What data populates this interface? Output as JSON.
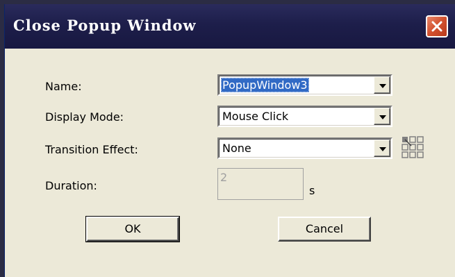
{
  "window": {
    "title": "Close Popup Window"
  },
  "form": {
    "name": {
      "label": "Name:",
      "value": "PopupWindow3"
    },
    "display_mode": {
      "label": "Display Mode:",
      "value": "Mouse Click"
    },
    "transition_effect": {
      "label": "Transition Effect:",
      "value": "None"
    },
    "duration": {
      "label": "Duration:",
      "value": "2",
      "unit": "s"
    }
  },
  "buttons": {
    "ok": "OK",
    "cancel": "Cancel"
  },
  "colors": {
    "titlebar": "#1d1e4a",
    "dialog_bg": "#ece9d8",
    "selection": "#316ac5",
    "close_button": "#d2502e"
  }
}
